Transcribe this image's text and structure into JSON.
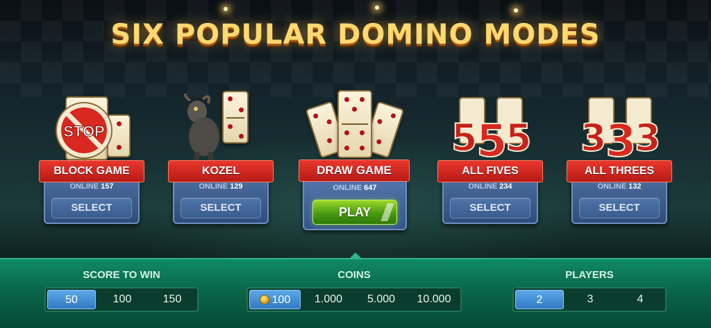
{
  "title": "SIX POPULAR DOMINO MODES",
  "modes": [
    {
      "name": "BLOCK GAME",
      "online_label": "ONLINE",
      "online_count": "157",
      "button": "SELECT",
      "icon": "stop-sign-icon"
    },
    {
      "name": "KOZEL",
      "online_label": "ONLINE",
      "online_count": "129",
      "button": "SELECT",
      "icon": "goat-icon"
    },
    {
      "name": "DRAW GAME",
      "online_label": "ONLINE",
      "online_count": "647",
      "button": "PLAY",
      "icon": "domino-fan-icon"
    },
    {
      "name": "ALL FIVES",
      "online_label": "ONLINE",
      "online_count": "234",
      "button": "SELECT",
      "icon": "fives-icon"
    },
    {
      "name": "ALL THREES",
      "online_label": "ONLINE",
      "online_count": "132",
      "button": "SELECT",
      "icon": "threes-icon"
    }
  ],
  "settings": {
    "score": {
      "label": "SCORE TO WIN",
      "options": [
        "50",
        "100",
        "150"
      ],
      "selected": "50"
    },
    "coins": {
      "label": "COINS",
      "options": [
        "100",
        "1.000",
        "5.000",
        "10.000"
      ],
      "selected": "100"
    },
    "players": {
      "label": "PLAYERS",
      "options": [
        "2",
        "3",
        "4"
      ],
      "selected": "2"
    }
  },
  "colors": {
    "title_gold": "#ffd870",
    "ribbon_red": "#d8281f",
    "panel_blue": "#3f6193",
    "play_green": "#4a9a12",
    "bottom_green": "#0a6a4c",
    "active_blue": "#3179c4"
  }
}
